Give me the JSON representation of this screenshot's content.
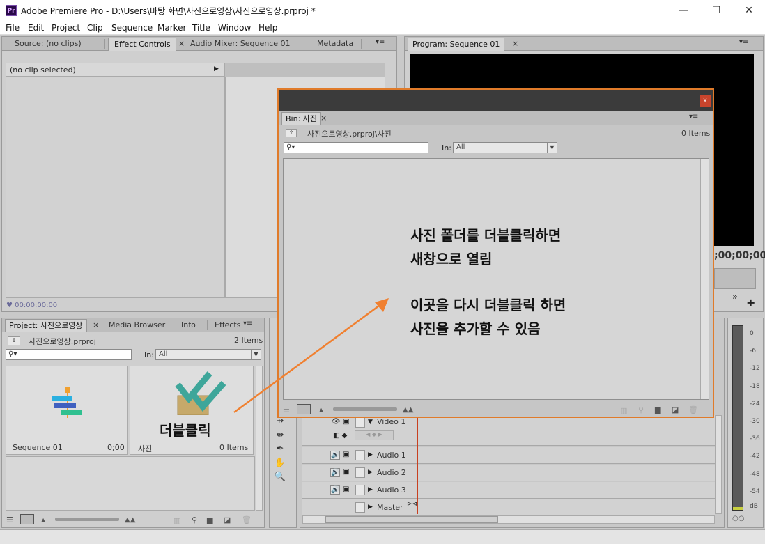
{
  "app": {
    "icon_text": "Pr",
    "title": "Adobe Premiere Pro - D:\\Users\\바탕 화면\\사진으로영상\\사진으로영상.prproj *",
    "window_buttons": {
      "minimize": "—",
      "maximize": "☐",
      "close": "✕"
    }
  },
  "menu": [
    "File",
    "Edit",
    "Project",
    "Clip",
    "Sequence",
    "Marker",
    "Title",
    "Window",
    "Help"
  ],
  "source_panel": {
    "tabs": [
      "Source: (no clips)",
      "Effect Controls",
      "Audio Mixer: Sequence 01",
      "Metadata"
    ],
    "active_tab": "Effect Controls",
    "close_glyph": "×",
    "menu_glyph": "▾≡",
    "clip_header": "(no clip selected)",
    "timecode": "00:00:00:00"
  },
  "program_panel": {
    "tab": "Program: Sequence 01",
    "timecode": ";00;00;00",
    "more_glyph": "»",
    "add_glyph": "+"
  },
  "project_panel": {
    "tabs": [
      "Project: 사진으로영상",
      "Media Browser",
      "Info",
      "Effects"
    ],
    "project_file": "사진으로영상.prproj",
    "item_count": "2 Items",
    "search_icon": "⚲▾",
    "in_label": "In:",
    "in_value": "All",
    "items": [
      {
        "name": "Sequence 01",
        "meta": "0;00"
      },
      {
        "name": "사진",
        "meta": "0 Items"
      }
    ],
    "double_click_label": "더블클릭"
  },
  "timeline": {
    "tracks": {
      "video": "Video 1",
      "audio": [
        "Audio 1",
        "Audio 2",
        "Audio 3"
      ],
      "master": "Master"
    }
  },
  "meter": {
    "labels": [
      "0",
      "-6",
      "-12",
      "-18",
      "-24",
      "-30",
      "-36",
      "-42",
      "-48",
      "-54",
      "dB"
    ],
    "footer": "○○"
  },
  "bin_window": {
    "close_glyph": "x",
    "tab": "Bin: 사진",
    "path": "사진으로영상.prproj\\사진",
    "item_count": "0 Items",
    "in_label": "In:",
    "in_value": "All",
    "annotation": {
      "line1": "사진 폴더를 더블클릭하면",
      "line2": "새창으로 열림",
      "line3": "이곳을 다시 더블클릭 하면",
      "line4": "사진을 추가할 수 있음"
    }
  },
  "colors": {
    "annotation_arrow": "#f08030",
    "bin_border": "#e07b2a",
    "playhead": "#c84020"
  }
}
